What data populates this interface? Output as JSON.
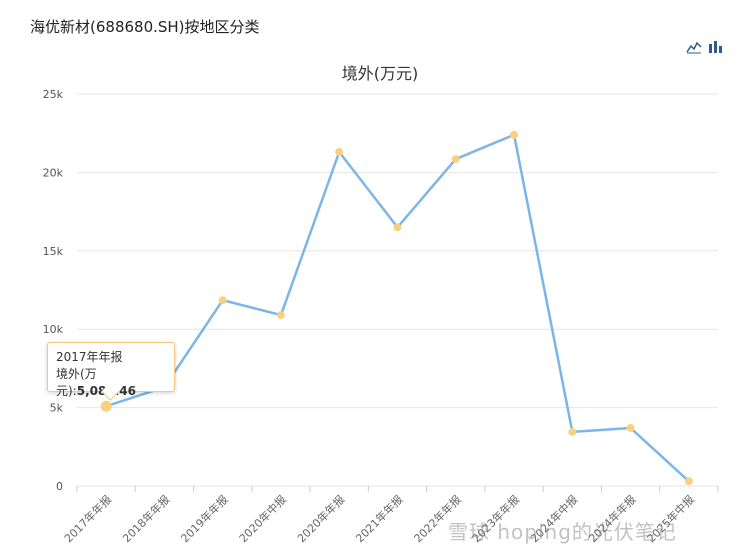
{
  "page": {
    "title": "海优新材(688680.SH)按地区分类",
    "watermark": "雪球 hoping的光伏笔记"
  },
  "toolbar": {
    "line_icon": "line-chart-icon",
    "bar_icon": "bar-chart-icon"
  },
  "chart_data": {
    "type": "line",
    "title": "境外(万元)",
    "categories": [
      "2017年年报",
      "2018年年报",
      "2019年年报",
      "2020年中报",
      "2020年年报",
      "2021年年报",
      "2022年年报",
      "2023年年报",
      "2024年中报",
      "2024年年报",
      "2025年中报"
    ],
    "series": [
      {
        "name": "境外(万元)",
        "values": [
          5086.46,
          6300,
          11850,
          10900,
          21300,
          16500,
          20850,
          22400,
          3450,
          3700,
          300
        ]
      }
    ],
    "yticks": [
      "0",
      "5k",
      "10k",
      "15k",
      "20k",
      "25k"
    ],
    "ylim": [
      0,
      25000
    ],
    "grid": true,
    "colors": {
      "line": "#7cb5e6",
      "marker": "#f7d17f",
      "grid": "#e6e6e6"
    }
  },
  "tooltip": {
    "category": "2017年年报",
    "series_label": "境外(万元):",
    "value_text": "5,086.46"
  }
}
